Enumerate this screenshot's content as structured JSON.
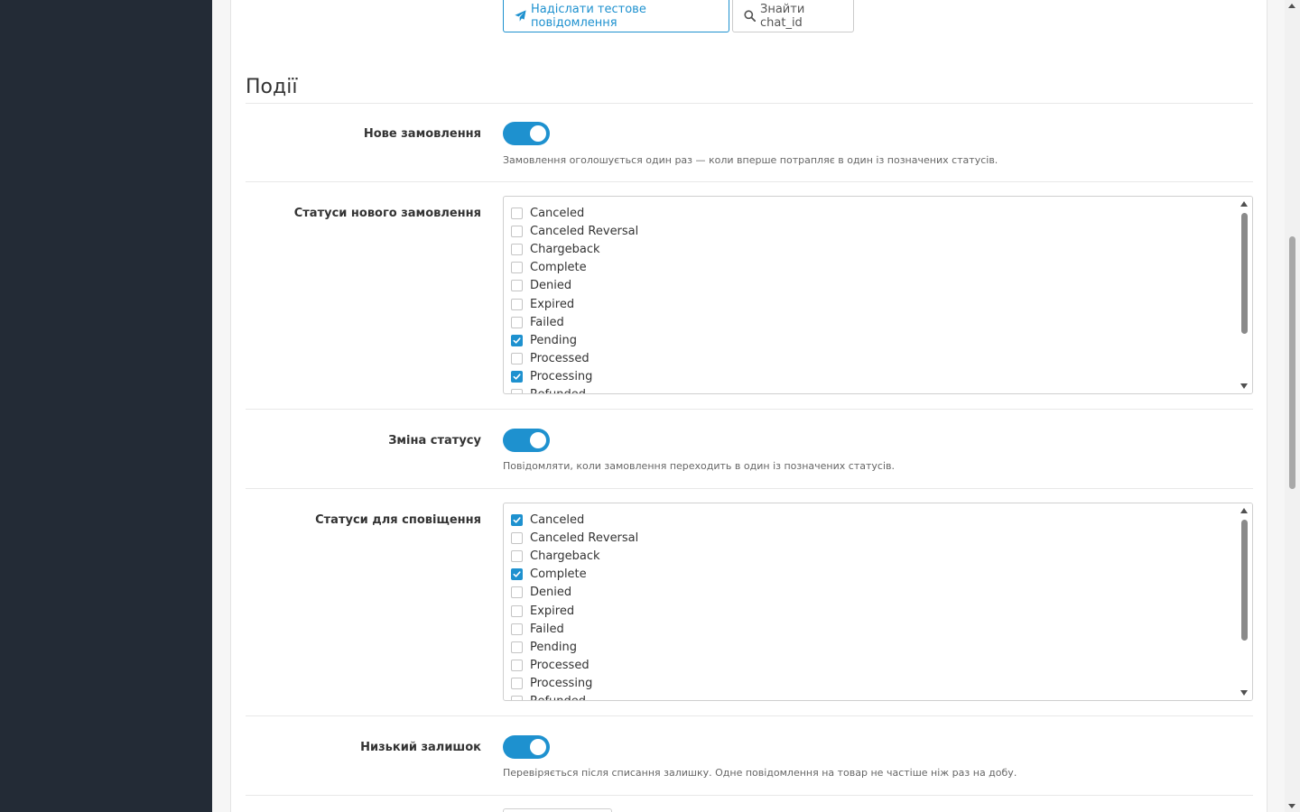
{
  "toolbar": {
    "test_button_label": "Надіслати тестове повідомлення",
    "find_chat_button_label": "Знайти chat_id"
  },
  "section": {
    "title": "Події"
  },
  "events": {
    "new_order": {
      "label": "Нове замовлення",
      "enabled": true,
      "help": "Замовлення оголошується один раз — коли вперше потрапляє в один із позначених статусів."
    },
    "new_order_statuses": {
      "label": "Статуси нового замовлення",
      "options": [
        {
          "label": "Canceled",
          "checked": false
        },
        {
          "label": "Canceled Reversal",
          "checked": false
        },
        {
          "label": "Chargeback",
          "checked": false
        },
        {
          "label": "Complete",
          "checked": false
        },
        {
          "label": "Denied",
          "checked": false
        },
        {
          "label": "Expired",
          "checked": false
        },
        {
          "label": "Failed",
          "checked": false
        },
        {
          "label": "Pending",
          "checked": true
        },
        {
          "label": "Processed",
          "checked": false
        },
        {
          "label": "Processing",
          "checked": true
        },
        {
          "label": "Refunded",
          "checked": false
        }
      ]
    },
    "status_change": {
      "label": "Зміна статусу",
      "enabled": true,
      "help": "Повідомляти, коли замовлення переходить в один із позначених статусів."
    },
    "notify_statuses": {
      "label": "Статуси для сповіщення",
      "options": [
        {
          "label": "Canceled",
          "checked": true
        },
        {
          "label": "Canceled Reversal",
          "checked": false
        },
        {
          "label": "Chargeback",
          "checked": false
        },
        {
          "label": "Complete",
          "checked": true
        },
        {
          "label": "Denied",
          "checked": false
        },
        {
          "label": "Expired",
          "checked": false
        },
        {
          "label": "Failed",
          "checked": false
        },
        {
          "label": "Pending",
          "checked": false
        },
        {
          "label": "Processed",
          "checked": false
        },
        {
          "label": "Processing",
          "checked": false
        },
        {
          "label": "Refunded",
          "checked": false
        }
      ]
    },
    "low_stock": {
      "label": "Низький залишок",
      "enabled": true,
      "help": "Перевіряється після списання залишку. Одне повідомлення на товар не частіше ніж раз на добу."
    }
  },
  "colors": {
    "accent": "#1e91cf",
    "sidebar": "#232b36"
  }
}
